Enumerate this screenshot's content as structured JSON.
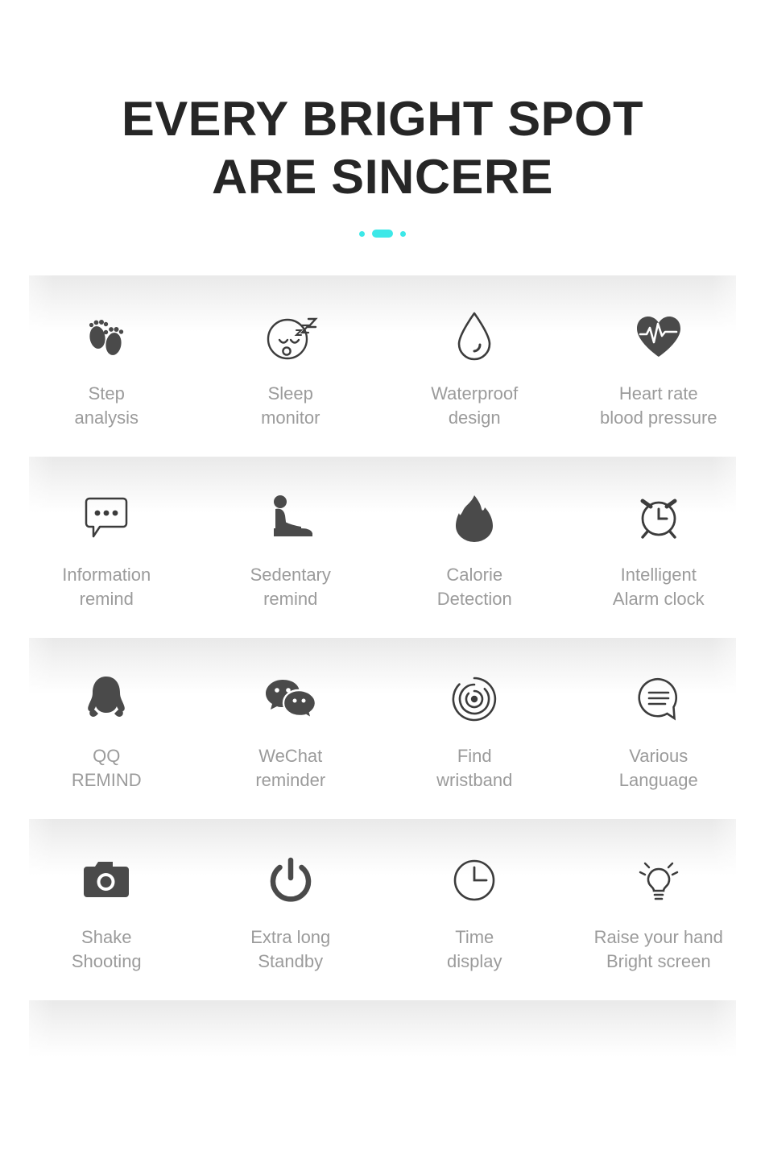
{
  "header": {
    "title_line_1": "EVERY BRIGHT SPOT",
    "title_line_2": "ARE SINCERE",
    "accent_color": "#3DE8E8",
    "title_color": "#262626"
  },
  "styles": {
    "label_color": "#9B9B9B",
    "icon_color": "#4A4A4A",
    "band_color": "#E9E9E9",
    "background": "#FFFFFF"
  },
  "features": {
    "rows": [
      {
        "items": [
          {
            "icon": "footprints-icon",
            "label": "Step\nanalysis"
          },
          {
            "icon": "sleeping-face-icon",
            "label": "Sleep\nmonitor"
          },
          {
            "icon": "water-drop-icon",
            "label": "Waterproof\ndesign"
          },
          {
            "icon": "heart-pulse-icon",
            "label": "Heart rate\nblood pressure"
          }
        ]
      },
      {
        "items": [
          {
            "icon": "message-bubble-icon",
            "label": "Information\nremind"
          },
          {
            "icon": "seated-person-icon",
            "label": "Sedentary\nremind"
          },
          {
            "icon": "flame-icon",
            "label": "Calorie\nDetection"
          },
          {
            "icon": "alarm-clock-icon",
            "label": "Intelligent\nAlarm clock"
          }
        ]
      },
      {
        "items": [
          {
            "icon": "qq-penguin-icon",
            "label": "QQ\nREMIND"
          },
          {
            "icon": "wechat-icon",
            "label": "WeChat\nreminder"
          },
          {
            "icon": "radar-locate-icon",
            "label": "Find\nwristband"
          },
          {
            "icon": "language-bubble-icon",
            "label": "Various\nLanguage"
          }
        ]
      },
      {
        "items": [
          {
            "icon": "camera-icon",
            "label": "Shake\nShooting"
          },
          {
            "icon": "power-icon",
            "label": "Extra long\nStandby"
          },
          {
            "icon": "clock-icon",
            "label": "Time\ndisplay"
          },
          {
            "icon": "lightbulb-icon",
            "label": "Raise your hand\nBright screen"
          }
        ]
      }
    ]
  }
}
